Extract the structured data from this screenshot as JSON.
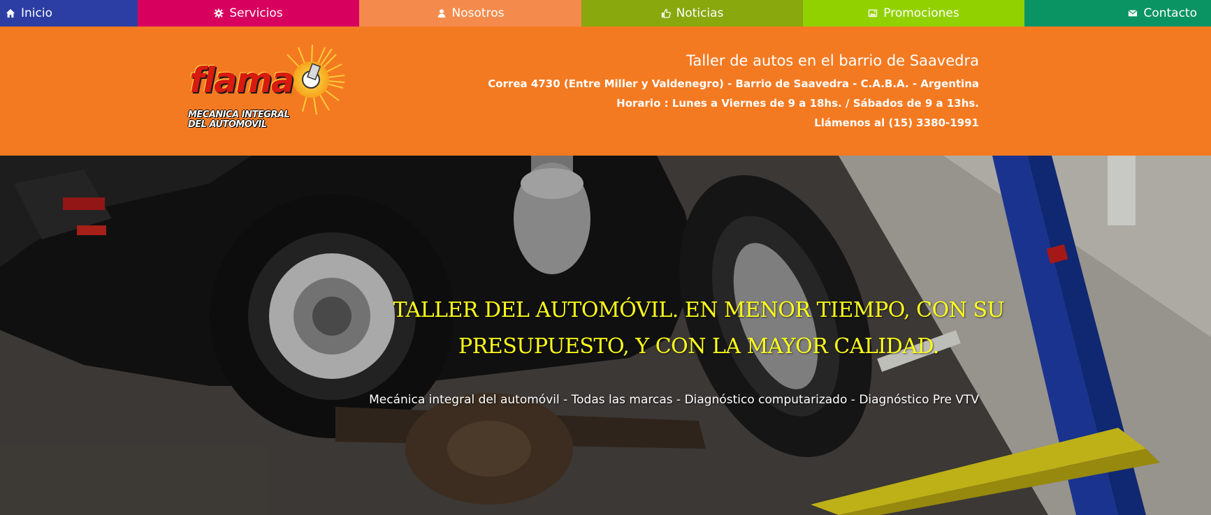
{
  "nav": {
    "items": [
      {
        "label": "Inicio",
        "icon": "home-icon",
        "color": "#2c3ea3"
      },
      {
        "label": "Servicios",
        "icon": "gear-icon",
        "color": "#d8005f"
      },
      {
        "label": "Nosotros",
        "icon": "user-icon",
        "color": "#f48b4c"
      },
      {
        "label": "Noticias",
        "icon": "thumbs-up-icon",
        "color": "#88a80d"
      },
      {
        "label": "Promociones",
        "icon": "picture-icon",
        "color": "#92d100"
      },
      {
        "label": "Contacto",
        "icon": "envelope-icon",
        "color": "#0a9463"
      }
    ]
  },
  "header": {
    "background": "#f47a22",
    "logo": {
      "brand": "flama",
      "subtitle_line1": "MECANICA INTEGRAL",
      "subtitle_line2": "DEL AUTOMOVIL"
    },
    "tagline": "Taller de autos en el barrio de Saavedra",
    "address": "Correa 4730 (Entre Miller y Valdenegro) - Barrio de Saavedra - C.A.B.A. - Argentina",
    "hours": "Horario : Lunes a Viernes de 9 a 18hs. / Sábados de 9 a 13hs.",
    "phone": "Llámenos al (15) 3380-1991"
  },
  "hero": {
    "headline": "TALLER DEL AUTOMÓVIL. EN MENOR TIEMPO, CON SU PRESUPUESTO, Y CON LA MAYOR CALIDAD.",
    "subline": "Mecánica integral del automóvil - Todas las marcas - Diagnóstico computarizado - Diagnóstico Pre VTV",
    "headline_color": "#ffff1a"
  }
}
